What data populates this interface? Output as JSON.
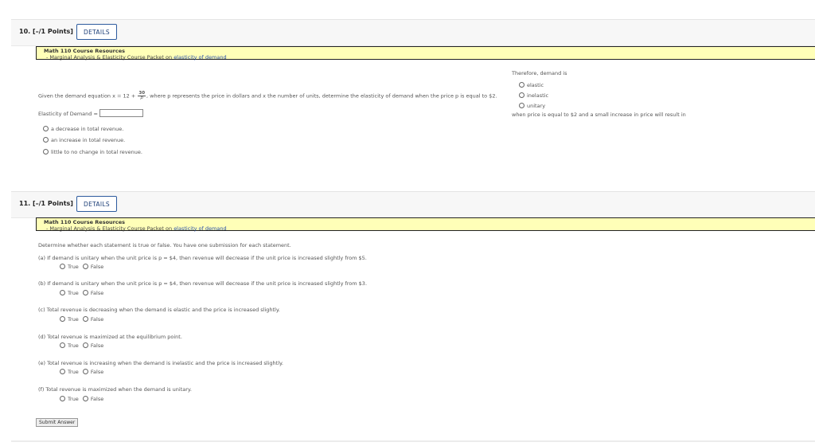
{
  "q10": {
    "number": "10.",
    "points": "[–/1 Points]",
    "details_label": "DETAILS",
    "resource_title": "Math 110 Course Resources",
    "resource_prefix": "- Marginal Analysis & Elasticity Course Packet on ",
    "resource_link": "elasticity of demand",
    "question_a": "Given the demand equation x = 12 + ",
    "frac_num": "30",
    "frac_den": "p",
    "question_b": ", where p represents the price in dollars and x the number of units, determine the elasticity of demand when the price p is equal to $2.",
    "elasticity_label": "Elasticity of Demand =",
    "elasticity_value": "",
    "right_therefore": "Therefore, demand is",
    "right_options": [
      "elastic",
      "inelastic",
      "unitary"
    ],
    "right_when": "when price is equal to $2 and a small increase in price will result in",
    "revenue_options": [
      "a decrease in total revenue.",
      "an increase in total revenue.",
      "little to no change in total revenue."
    ]
  },
  "q11": {
    "number": "11.",
    "points": "[–/1 Points]",
    "details_label": "DETAILS",
    "resource_title": "Math 110 Course Resources",
    "resource_prefix": "- Marginal Analysis & Elasticity Course Packet on ",
    "resource_link": "elasticity of demand",
    "intro": "Determine whether each statement is true or false. You have one submission for each statement.",
    "true_label": "True",
    "false_label": "False",
    "statements": [
      "(a) If demand is unitary when the unit price is p = $4, then revenue will decrease if the unit price is increased slightly from $5.",
      "(b) If demand is unitary when the unit price is p = $4, then revenue will decrease if the unit price is increased slightly from $3.",
      "(c) Total revenue is decreasing when the demand is elastic and the price is increased slightly.",
      "(d) Total revenue is maximized at the equilibrium point.",
      "(e) Total revenue is increasing when the demand is inelastic and the price is increased slightly.",
      "(f) Total revenue is maximized when the demand is unitary."
    ],
    "submit_label": "Submit Answer"
  }
}
